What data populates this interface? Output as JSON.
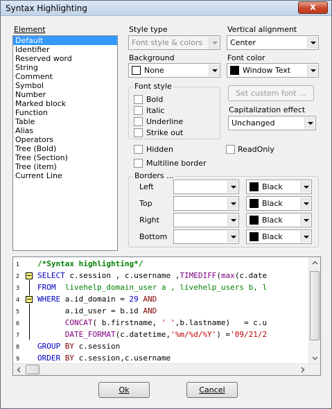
{
  "window": {
    "title": "Syntax Highlighting",
    "close_glyph": "x"
  },
  "element": {
    "label": "Element",
    "items": [
      "Default",
      "Identifier",
      "Reserved word",
      "String",
      "Comment",
      "Symbol",
      "Number",
      "Marked block",
      "Function",
      "Table",
      "Alias",
      "Operators",
      "Tree (Bold)",
      "Tree (Section)",
      "Tree (item)",
      "Current Line"
    ],
    "selected": "Default"
  },
  "style_type": {
    "label": "Style type",
    "value": "Font style & colors"
  },
  "vertical_alignment": {
    "label": "Vertical alignment",
    "value": "Center"
  },
  "background": {
    "label": "Background",
    "value": "None",
    "color": "#ffffff"
  },
  "font_color": {
    "label": "Font color",
    "value": "Window Text",
    "color": "#000000"
  },
  "font_style": {
    "label": "Font style",
    "bold": "Bold",
    "italic": "Italic",
    "underline": "Underline",
    "strike_out": "Strike out"
  },
  "set_custom_font": "Set custom font ...",
  "capitalization": {
    "label": "Capitalization effect",
    "value": "Unchanged"
  },
  "hidden": "Hidden",
  "readonly": "ReadOnly",
  "multiline_border": "Multiline border",
  "borders": {
    "label": "Borders ...",
    "left": {
      "label": "Left",
      "color_name": "Black"
    },
    "top": {
      "label": "Top",
      "color_name": "Black"
    },
    "right": {
      "label": "Right",
      "color_name": "Black"
    },
    "bottom": {
      "label": "Bottom",
      "color_name": "Black"
    }
  },
  "editor": {
    "line_numbers": [
      "1",
      "2",
      "3",
      "4",
      "5",
      "6",
      "7",
      "8",
      "9"
    ],
    "lines": {
      "l1": "/*Syntax highlighting*/",
      "l2_kw": "SELECT",
      "l2_rest": " c.session , c.username ,",
      "l2_fn": "TIMEDIFF",
      "l2_p": "(",
      "l2_fn2": "max",
      "l2_tail": "(c.date",
      "l3_kw": "FROM",
      "l3_rest": "  livehelp_domain_user a , livehelp_users b, l",
      "l4_kw": "WHERE",
      "l4_rest": " a.id_domain = ",
      "l4_num": "29",
      "l4_and": " AND",
      "l5_rest": "      a.id_user = b.id ",
      "l5_and": "AND",
      "l6_fn": "      CONCAT",
      "l6_rest": "( b.firstname, ",
      "l6_str": "' '",
      "l6_rest2": ",b.lastname)   = c.u",
      "l7_fn": "      DATE_FORMAT",
      "l7_rest": "(c.datetime,",
      "l7_str": "'%m/%d/%Y'",
      "l7_rest2": ") =",
      "l7_str2": "'09/21/2",
      "l8_kw": "GROUP",
      "l8_by": " BY",
      "l8_rest": " c.session",
      "l9_kw": "ORDER",
      "l9_by": " BY",
      "l9_rest": " c.session,c.username"
    }
  },
  "ok": "Ok",
  "cancel": "Cancel",
  "colors": {
    "keyword": "#0000c0",
    "function": "#800080",
    "string": "#c00000",
    "comment": "#008000",
    "number": "#0000c0",
    "selection": "#3399ff"
  }
}
